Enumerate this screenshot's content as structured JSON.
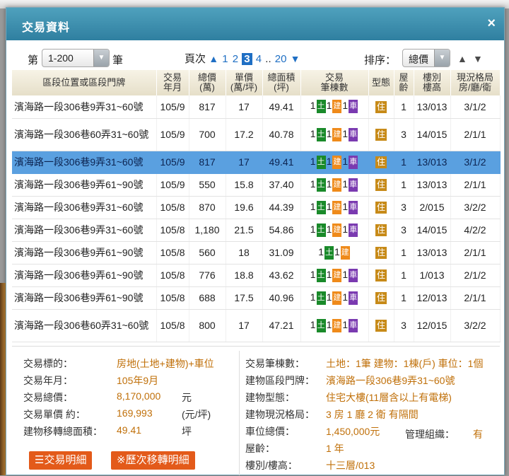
{
  "dialog": {
    "title": "交易資料",
    "close_icon": "×"
  },
  "controls": {
    "range_prefix": "第",
    "range_value": "1-200",
    "range_suffix": "筆",
    "page_label": "頁次",
    "pages_before": [
      "1",
      "2"
    ],
    "current_page": "3",
    "page_after": "4",
    "ellipsis": "..",
    "last_page": "20",
    "sort_label": "排序：",
    "sort_value": "總價"
  },
  "table": {
    "headers": [
      "區段位置或區段門牌",
      "交易\n年月",
      "總價\n(萬)",
      "單價\n(萬/坪)",
      "總面積\n(坪)",
      "交易\n筆棟數",
      "型態",
      "屋\n齡",
      "樓別\n樓高",
      "現況格局\n房/廳/衛"
    ],
    "rows": [
      {
        "addr": "濱海路一段306巷9弄31~60號",
        "ym": "105/9",
        "total": "817",
        "unit": "17",
        "area": "49.41",
        "land": "1",
        "bld": "1",
        "car": "1",
        "type": "住",
        "age": "1",
        "floor": "13/013",
        "layout": "3/1/2"
      },
      {
        "addr": "濱海路一段306巷60弄31~60號",
        "ym": "105/9",
        "total": "700",
        "unit": "17.2",
        "area": "40.78",
        "land": "1",
        "bld": "1",
        "car": "1",
        "type": "住",
        "age": "3",
        "floor": "14/015",
        "layout": "2/1/1"
      },
      {
        "addr": "濱海路一段306巷9弄31~60號",
        "ym": "105/9",
        "total": "817",
        "unit": "17",
        "area": "49.41",
        "land": "1",
        "bld": "1",
        "car": "1",
        "type": "住",
        "age": "1",
        "floor": "13/013",
        "layout": "3/1/2"
      },
      {
        "addr": "濱海路一段306巷9弄61~90號",
        "ym": "105/9",
        "total": "550",
        "unit": "15.8",
        "area": "37.40",
        "land": "1",
        "bld": "1",
        "car": "1",
        "type": "住",
        "age": "1",
        "floor": "13/013",
        "layout": "2/1/1"
      },
      {
        "addr": "濱海路一段306巷9弄31~60號",
        "ym": "105/8",
        "total": "870",
        "unit": "19.6",
        "area": "44.39",
        "land": "1",
        "bld": "1",
        "car": "1",
        "type": "住",
        "age": "3",
        "floor": "2/015",
        "layout": "3/2/2"
      },
      {
        "addr": "濱海路一段306巷9弄31~60號",
        "ym": "105/8",
        "total": "1,180",
        "unit": "21.5",
        "area": "54.86",
        "land": "1",
        "bld": "1",
        "car": "1",
        "type": "住",
        "age": "3",
        "floor": "14/015",
        "layout": "4/2/2"
      },
      {
        "addr": "濱海路一段306巷9弄61~90號",
        "ym": "105/8",
        "total": "560",
        "unit": "18",
        "area": "31.09",
        "land": "1",
        "bld": "1",
        "car": "",
        "type": "住",
        "age": "1",
        "floor": "13/013",
        "layout": "2/1/1"
      },
      {
        "addr": "濱海路一段306巷9弄61~90號",
        "ym": "105/8",
        "total": "776",
        "unit": "18.8",
        "area": "43.62",
        "land": "1",
        "bld": "1",
        "car": "1",
        "type": "住",
        "age": "1",
        "floor": "1/013",
        "layout": "2/1/2"
      },
      {
        "addr": "濱海路一段306巷9弄61~90號",
        "ym": "105/8",
        "total": "688",
        "unit": "17.5",
        "area": "40.96",
        "land": "1",
        "bld": "1",
        "car": "1",
        "type": "住",
        "age": "1",
        "floor": "12/013",
        "layout": "2/1/1"
      },
      {
        "addr": "濱海路一段306巷60弄31~60號",
        "ym": "105/8",
        "total": "800",
        "unit": "17",
        "area": "47.21",
        "land": "1",
        "bld": "1",
        "car": "1",
        "type": "住",
        "age": "3",
        "floor": "12/015",
        "layout": "3/2/2"
      }
    ],
    "badge_land": "土",
    "badge_bld": "建",
    "badge_car": "車"
  },
  "detail": {
    "left": [
      {
        "k": "交易標的：",
        "v": "房地(土地+建物)+車位",
        "u": ""
      },
      {
        "k": "交易年月：",
        "v": "105年9月",
        "u": ""
      },
      {
        "k": "交易總價：",
        "v": "8,170,000",
        "u": "元"
      },
      {
        "k": "交易單價 約：",
        "v": "169,993",
        "u": "(元/坪)"
      },
      {
        "k": "建物移轉總面積：",
        "v": "49.41",
        "u": "坪"
      }
    ],
    "right": [
      {
        "k": "交易筆棟數：",
        "v": "土地：1筆 建物：1棟(戶) 車位：1個"
      },
      {
        "k": "建物區段門牌：",
        "v": "濱海路一段306巷9弄31~60號"
      },
      {
        "k": "建物型態：",
        "v": "住宅大樓(11層含以上有電梯)"
      },
      {
        "k": "建物現況格局：",
        "v": "3 房 1 廳 2 衛 有隔間"
      },
      {
        "k": "車位總價：",
        "v": "1,450,000元"
      },
      {
        "k": "屋齡：",
        "v": "1 年"
      },
      {
        "k": "樓別/樓高：",
        "v": "十三層/013"
      }
    ],
    "mgmt_label": "管理組織：",
    "mgmt_value": "有",
    "btn_detail": "☰交易明細",
    "btn_history": "※歷次移轉明細"
  }
}
